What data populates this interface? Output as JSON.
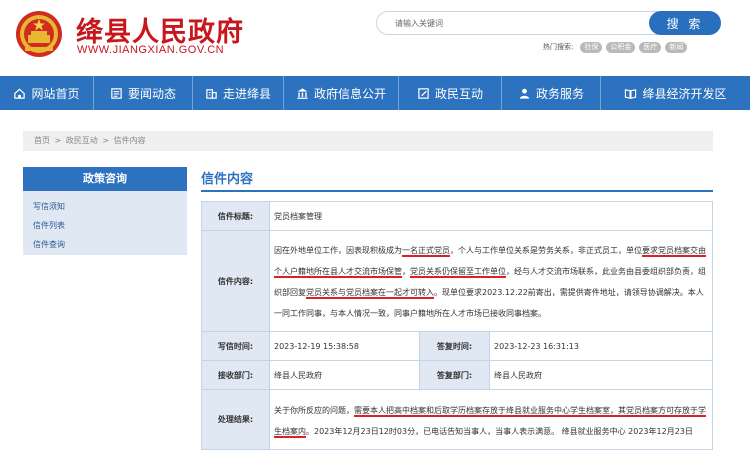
{
  "header": {
    "title": "绛县人民政府",
    "url": "WWW.JIANGXIAN.GOV.CN",
    "search": {
      "placeholder": "请输入关键词",
      "button": "搜 索"
    },
    "hot_search": {
      "label": "热门搜索:",
      "tags": [
        "社保",
        "公积金",
        "医疗",
        "新闻"
      ]
    },
    "colors": {
      "brand_red": "#c8161d",
      "primary_blue": "#2d72bf"
    }
  },
  "nav": {
    "items": [
      {
        "label": "网站首页",
        "icon": "home-icon"
      },
      {
        "label": "要闻动态",
        "icon": "news-icon"
      },
      {
        "label": "走进绛县",
        "icon": "building-icon"
      },
      {
        "label": "政府信息公开",
        "icon": "government-icon"
      },
      {
        "label": "政民互动",
        "icon": "edit-icon"
      },
      {
        "label": "政务服务",
        "icon": "user-icon"
      },
      {
        "label": "绛县经济开发区",
        "icon": "book-icon"
      }
    ]
  },
  "breadcrumb": [
    "首页",
    ">",
    "政民互动",
    ">",
    "信件内容"
  ],
  "sidebar": {
    "title": "政策咨询",
    "items": [
      "写信须知",
      "信件列表",
      "信件查询"
    ]
  },
  "main": {
    "title": "信件内容",
    "letter": {
      "title_label": "信件标题:",
      "title_value": "党员档案管理",
      "content_label": "信件内容:",
      "content_parts": [
        "因在外地单位工作，因表现积极成为",
        "一名正式党员",
        "，个人与工作单位关系是劳务关系，非正式员工，单位",
        "要求党员档案交由个人户籍地所在县人才交流市场保管",
        "，",
        "党员关系仍保留至工作单位",
        "，经与人才交流市场联系，此业务由县委组织部负责，组织部回复",
        "党员关系与党员档案在一起才可转入",
        "。现单位要求2023.12.22前寄出，需提供寄件地址，请领导协调解决。本人一同工作同事，与本人情况一致，同事户籍地所在人才市场已接收同事档案。"
      ],
      "write_time_label": "写信时间:",
      "write_time": "2023-12-19 15:38:58",
      "reply_time_label": "答复时间:",
      "reply_time": "2023-12-23 16:31:13",
      "receiver_label": "接收部门:",
      "receiver": "绛县人民政府",
      "replier_label": "答复部门:",
      "replier": "绛县人民政府",
      "result_label": "处理结果:",
      "result_parts": [
        "关于你所反应的问题，",
        "需要本人把高中档案和后取学历档案存放于绛县就业服务中心学生档案室，其党员档案方可存放于学生档案内",
        "。2023年12月23日12时03分，已电话告知当事人，当事人表示满意。 绛县就业服务中心 2023年12月23日"
      ]
    }
  }
}
